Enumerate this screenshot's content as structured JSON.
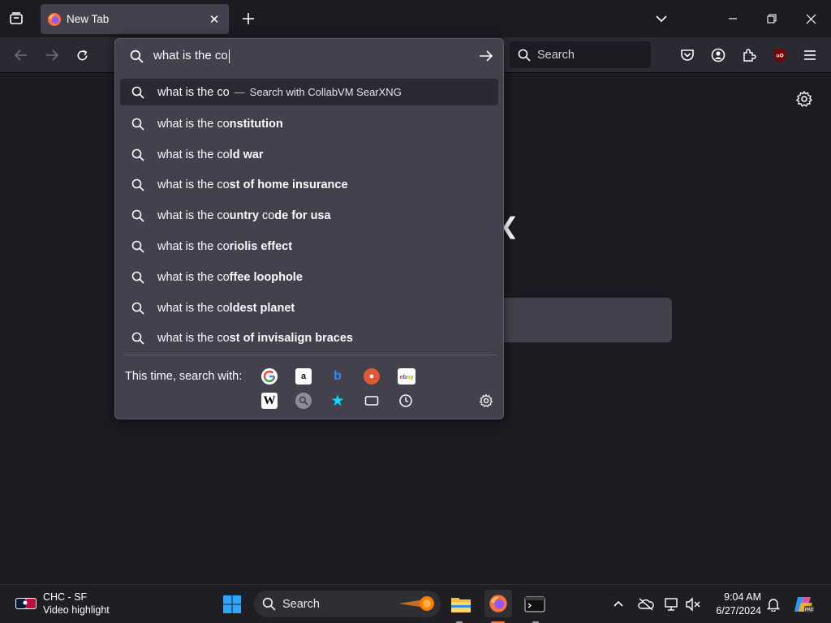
{
  "browser": {
    "tab": {
      "title": "New Tab",
      "close_glyph": "✕"
    },
    "window_controls": {
      "list_all_tabs": "chevron-down-icon",
      "minimize": "—",
      "restore": "❐",
      "close": "✕"
    },
    "search_box": {
      "placeholder": "Search"
    }
  },
  "urlbar": {
    "value": "what is the co",
    "heuristic": {
      "typed": "what is the co",
      "separator": "—",
      "action": "Search with CollabVM SearXNG"
    },
    "suggestions": [
      {
        "prefix": "what is the co",
        "bold": "nstitution",
        "rest": ""
      },
      {
        "prefix": "what is the co",
        "bold": "ld war",
        "rest": ""
      },
      {
        "prefix": "what is the co",
        "bold": "st of home insurance",
        "rest": ""
      },
      {
        "prefix": "what is the co",
        "bold": "untry",
        "mid": " co",
        "bold2": "de for usa"
      },
      {
        "prefix": "what is the co",
        "bold": "riolis effect",
        "rest": ""
      },
      {
        "prefix": "what is the co",
        "bold": "ffee loophole",
        "rest": ""
      },
      {
        "prefix": "what is the co",
        "bold": "ldest planet",
        "rest": ""
      },
      {
        "prefix": "what is the co",
        "bold": "st of invisalign braces",
        "rest": ""
      }
    ],
    "one_off_label": "This time, search with:",
    "engines": [
      "google-icon",
      "amazon-icon",
      "bing-icon",
      "duckduckgo-icon",
      "ebay-icon",
      "wikipedia-icon",
      "searxng-icon",
      "bookmarks-icon",
      "tabs-icon",
      "history-icon"
    ]
  },
  "taskbar": {
    "widget": {
      "line1": "CHC - SF",
      "line2": "Video highlight"
    },
    "search_label": "Search",
    "clock": {
      "time": "9:04 AM",
      "date": "6/27/2024"
    }
  },
  "colors": {
    "accent_blue": "#00ddff",
    "firefox_orange": "#ff7139",
    "panel": "#42414d"
  }
}
